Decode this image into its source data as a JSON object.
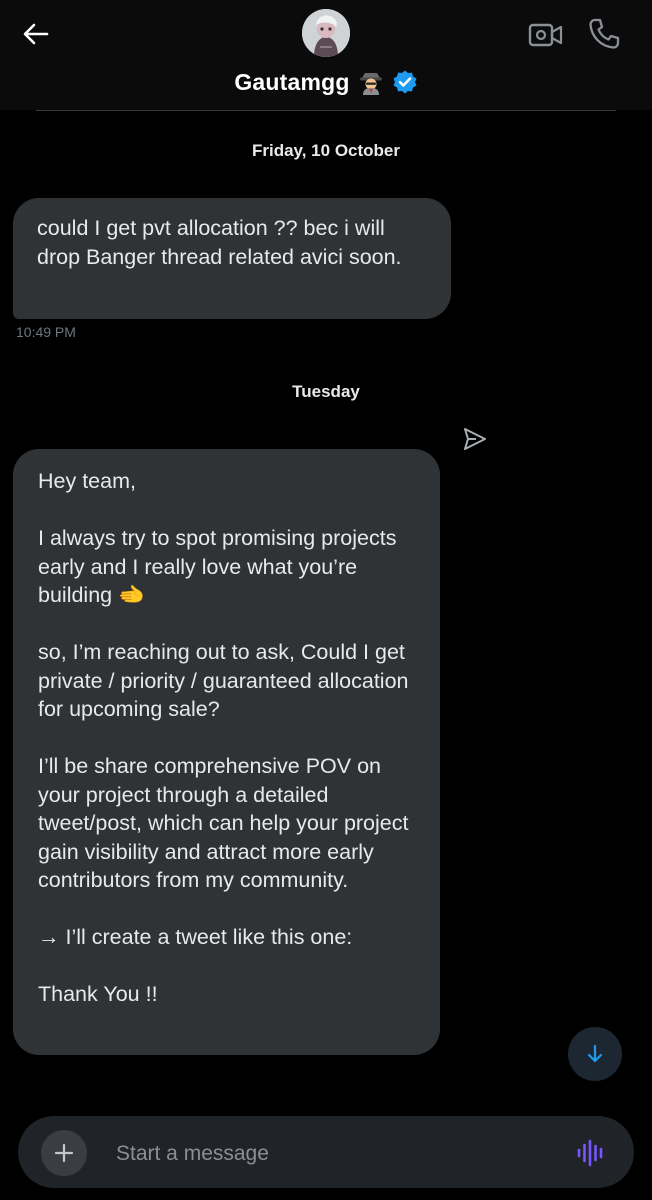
{
  "header": {
    "contact_name": "Gautamgg",
    "name_emoji": "🕵",
    "icons": {
      "back": "arrow-left-icon",
      "video": "video-call-icon",
      "call": "phone-icon",
      "verified": "verified-badge-icon"
    }
  },
  "conversation": {
    "date_separator_1": "Friday, 10 October",
    "message_1": {
      "text": "could I get pvt allocation ?? bec i will drop Banger thread related avici soon.",
      "time": "10:49 PM"
    },
    "date_separator_2": "Tuesday",
    "message_2": {
      "paragraphs": [
        "Hey team,",
        "I always try to spot promising projects early and I really love what you’re building 🫲",
        "so, I’m reaching out to ask, Could I get private / priority / guaranteed allocation for upcoming sale?",
        "I’ll be share comprehensive POV on your project through a detailed tweet/post, which can help your project gain visibility and attract more early contributors from my community.",
        "→ I’ll create a tweet like this one:",
        "Thank You !!"
      ]
    }
  },
  "composer": {
    "placeholder": "Start a message",
    "icons": {
      "add": "plus-icon",
      "voice": "voice-wave-icon",
      "scroll": "arrow-down-icon",
      "send": "send-icon"
    }
  },
  "colors": {
    "background": "#000000",
    "bubble": "#2f3336",
    "accent": "#1d9bf0",
    "voice_accent": "#7856ff"
  }
}
